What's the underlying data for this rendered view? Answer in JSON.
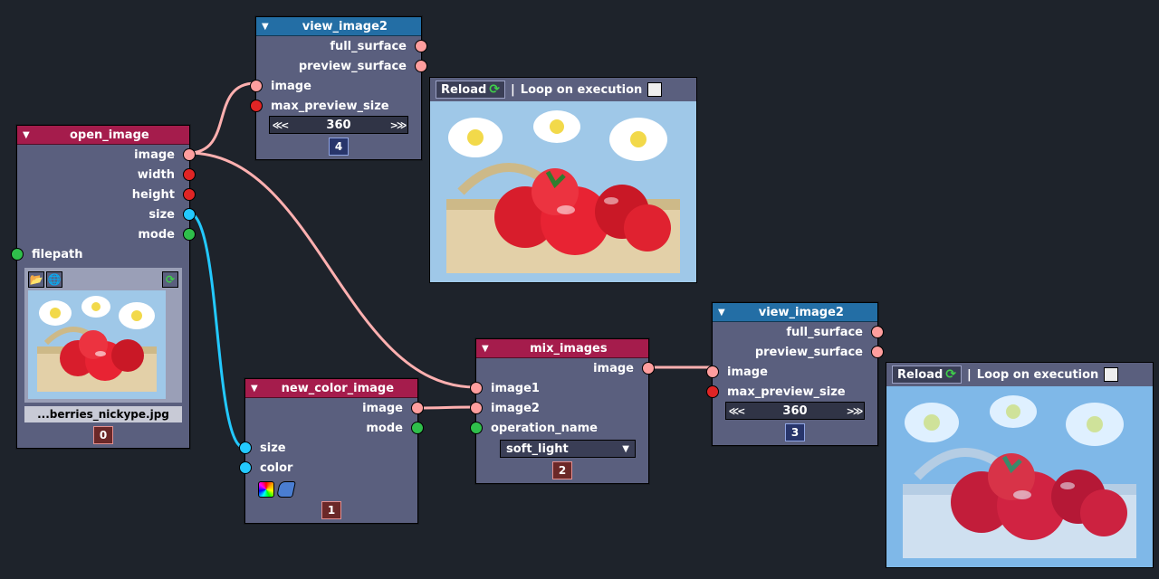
{
  "nodes": {
    "open_image": {
      "title": "open_image",
      "outputs": [
        "image",
        "width",
        "height",
        "size",
        "mode"
      ],
      "input": "filepath",
      "file_label": "...berries_nickype.jpg",
      "badge": "0"
    },
    "view_image2_top": {
      "title": "view_image2",
      "outputs": [
        "full_surface",
        "preview_surface"
      ],
      "inputs": [
        "image",
        "max_preview_size"
      ],
      "stepper": "360",
      "badge": "4"
    },
    "new_color_image": {
      "title": "new_color_image",
      "outputs": [
        "image",
        "mode"
      ],
      "inputs": [
        "size",
        "color"
      ],
      "badge": "1"
    },
    "mix_images": {
      "title": "mix_images",
      "output": "image",
      "inputs": [
        "image1",
        "image2",
        "operation_name"
      ],
      "dropdown": "soft_light",
      "badge": "2"
    },
    "view_image2_right": {
      "title": "view_image2",
      "outputs": [
        "full_surface",
        "preview_surface"
      ],
      "inputs": [
        "image",
        "max_preview_size"
      ],
      "stepper": "360",
      "badge": "3"
    }
  },
  "panels": {
    "reload": "Reload",
    "loop": "Loop on execution"
  },
  "stepper_left": "≪<",
  "stepper_right": ">≫"
}
